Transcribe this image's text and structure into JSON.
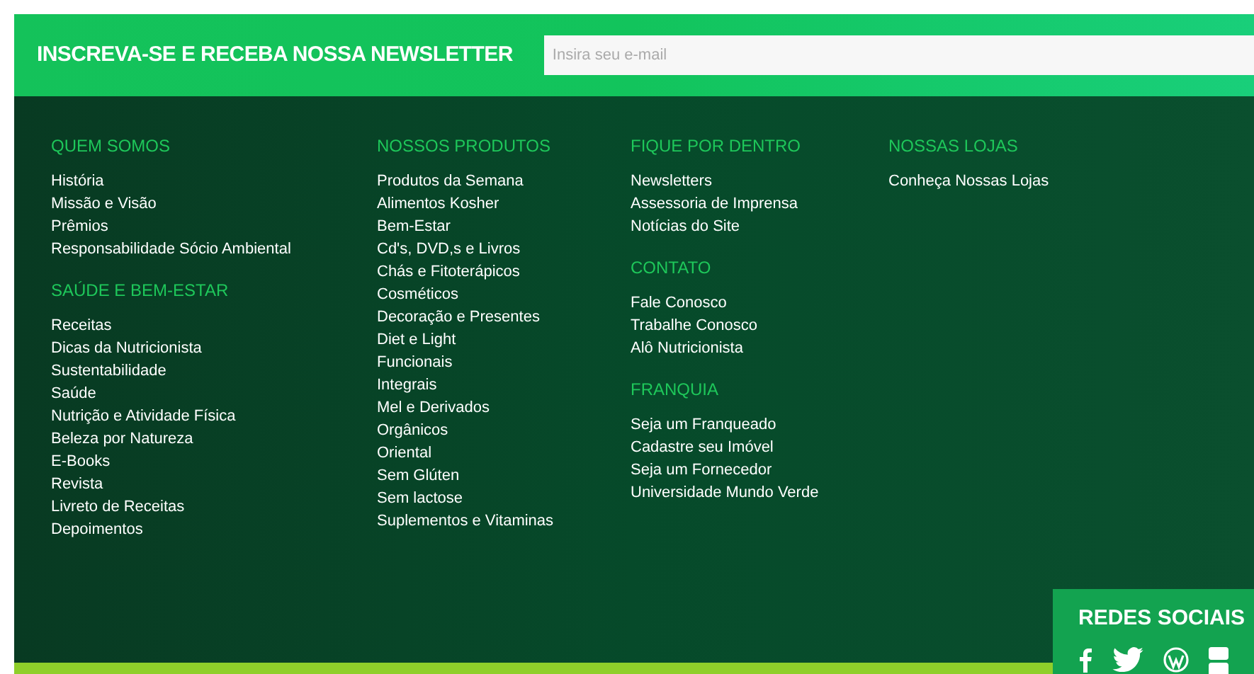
{
  "newsletter": {
    "title": "INSCREVA-SE E RECEBA NOSSA NEWSLETTER",
    "placeholder": "Insira seu e-mail"
  },
  "columns": [
    {
      "sections": [
        {
          "heading": "QUEM SOMOS",
          "links": [
            "História",
            "Missão e Visão",
            "Prêmios",
            "Responsabilidade Sócio Ambiental"
          ]
        },
        {
          "heading": "SAÚDE E BEM-ESTAR",
          "links": [
            "Receitas",
            "Dicas da Nutricionista",
            "Sustentabilidade",
            "Saúde",
            "Nutrição e Atividade Física",
            "Beleza por Natureza",
            "E-Books",
            "Revista",
            "Livreto de Receitas",
            "Depoimentos"
          ]
        }
      ]
    },
    {
      "sections": [
        {
          "heading": "NOSSOS PRODUTOS",
          "links": [
            "Produtos da Semana",
            "Alimentos Kosher",
            "Bem-Estar",
            "Cd's, DVD,s e Livros",
            "Chás e Fitoterápicos",
            "Cosméticos",
            "Decoração e Presentes",
            "Diet e Light",
            "Funcionais",
            "Integrais",
            "Mel e Derivados",
            "Orgânicos",
            "Oriental",
            "Sem Glúten",
            "Sem lactose",
            "Suplementos e Vitaminas"
          ]
        }
      ]
    },
    {
      "sections": [
        {
          "heading": "FIQUE POR DENTRO",
          "links": [
            "Newsletters",
            "Assessoria de Imprensa",
            "Notícias do Site"
          ]
        },
        {
          "heading": "CONTATO",
          "links": [
            "Fale Conosco",
            "Trabalhe Conosco",
            "Alô Nutricionista"
          ]
        },
        {
          "heading": "FRANQUIA",
          "links": [
            "Seja um Franqueado",
            "Cadastre seu Imóvel",
            "Seja um Fornecedor",
            "Universidade Mundo Verde"
          ]
        }
      ]
    },
    {
      "sections": [
        {
          "heading": "NOSSAS LOJAS",
          "links": [
            "Conheça Nossas Lojas"
          ]
        }
      ]
    }
  ],
  "social": {
    "title": "REDES SOCIAIS",
    "icons": [
      {
        "kind": "facebook"
      },
      {
        "kind": "twitter"
      },
      {
        "kind": "wordpress"
      },
      {
        "kind": "youtube"
      }
    ]
  }
}
